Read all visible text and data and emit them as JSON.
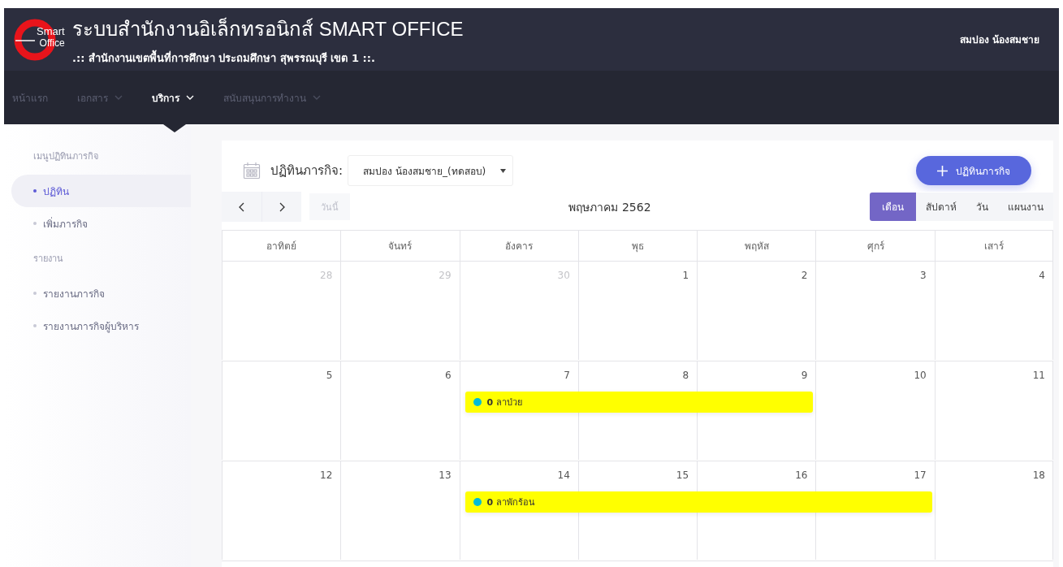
{
  "header": {
    "title": "ระบบสำนักงานอิเล็กทรอนิกส์ SMART OFFICE",
    "subtitle": ".:: สำนักงานเขตพื้นที่การศึกษา ประถมศึกษา สุพรรณบุรี เขต 1 ::.",
    "logo_line1": "Smart",
    "logo_line2": "Office",
    "user": "สมปอง น้องสมชาย"
  },
  "nav": [
    {
      "label": "หน้าแรก",
      "dropdown": false,
      "selected": false
    },
    {
      "label": "เอกสาร",
      "dropdown": true,
      "selected": false
    },
    {
      "label": "บริการ",
      "dropdown": true,
      "selected": true
    },
    {
      "label": "สนับสนุนการทำงาน",
      "dropdown": true,
      "selected": false
    }
  ],
  "sidebar": {
    "items": [
      {
        "kind": "heading",
        "label": "เมนูปฏิทินภารกิจ"
      },
      {
        "kind": "item",
        "label": "ปฏิทิน",
        "selected": true
      },
      {
        "kind": "item",
        "label": "เพิ่มภารกิจ",
        "selected": false
      },
      {
        "kind": "heading",
        "label": "รายงาน"
      },
      {
        "kind": "item",
        "label": "รายงานภารกิจ",
        "selected": false
      },
      {
        "kind": "item",
        "label": "รายงานภารกิจผู้บริหาร",
        "selected": false
      }
    ]
  },
  "calendar": {
    "label": "ปฏิทินภารกิจ:",
    "owner_select": "สมปอง น้องสมชาย_(ทดสอบ)",
    "add_button": "ปฏิทินภารกิจ",
    "today_button": "วันนี้",
    "month_title": "พฤษภาคม 2562",
    "views": [
      {
        "label": "เดือน",
        "selected": true
      },
      {
        "label": "สัปดาห์",
        "selected": false
      },
      {
        "label": "วัน",
        "selected": false
      },
      {
        "label": "แผนงาน",
        "selected": false
      }
    ],
    "weekdays": [
      "อาทิตย์",
      "จันทร์",
      "อังคาร",
      "พุธ",
      "พฤหัส",
      "ศุกร์",
      "เสาร์"
    ],
    "weeks": [
      {
        "days": [
          {
            "label": "28",
            "muted": true
          },
          {
            "label": "29",
            "muted": true
          },
          {
            "label": "30",
            "muted": true
          },
          {
            "label": "1",
            "muted": false
          },
          {
            "label": "2",
            "muted": false
          },
          {
            "label": "3",
            "muted": false
          },
          {
            "label": "4",
            "muted": false
          }
        ]
      },
      {
        "days": [
          {
            "label": "5",
            "muted": false
          },
          {
            "label": "6",
            "muted": false
          },
          {
            "label": "7",
            "muted": false
          },
          {
            "label": "8",
            "muted": false
          },
          {
            "label": "9",
            "muted": false
          },
          {
            "label": "10",
            "muted": false
          },
          {
            "label": "11",
            "muted": false
          }
        ],
        "events": [
          {
            "count": "0",
            "title": "ลาป่วย",
            "color": "#00bcd4",
            "covers": [
              false,
              false,
              true,
              true,
              true,
              false,
              false
            ]
          }
        ]
      },
      {
        "days": [
          {
            "label": "12",
            "muted": false
          },
          {
            "label": "13",
            "muted": false
          },
          {
            "label": "14",
            "muted": false
          },
          {
            "label": "15",
            "muted": false
          },
          {
            "label": "16",
            "muted": false
          },
          {
            "label": "17",
            "muted": false
          },
          {
            "label": "18",
            "muted": false
          }
        ],
        "events": [
          {
            "count": "0",
            "title": "ลาพักร้อน",
            "color": "#00bcd4",
            "covers": [
              false,
              false,
              true,
              true,
              true,
              true,
              false
            ]
          }
        ]
      }
    ]
  }
}
